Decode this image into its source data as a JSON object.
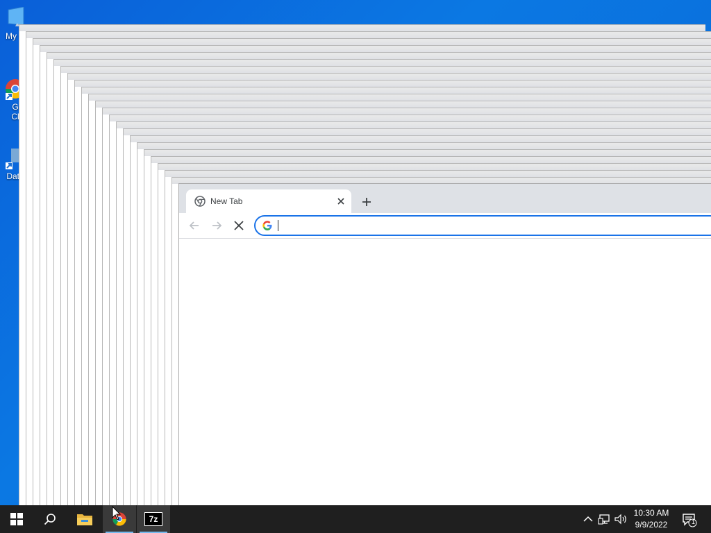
{
  "desktop": {
    "icons": [
      {
        "label": "My C",
        "icon": "computer-icon"
      },
      {
        "label": "G\nCl",
        "icon": "chrome-shortcut-icon"
      },
      {
        "label": "Data",
        "icon": "database-shortcut-icon"
      }
    ]
  },
  "browser": {
    "tab_title": "New Tab",
    "omnibox_value": "",
    "colors": {
      "accent": "#1a73e8",
      "tabstrip": "#dee1e6"
    }
  },
  "taskbar": {
    "apps": [
      "start-icon",
      "search-icon",
      "file-explorer-icon",
      "chrome-icon",
      "7zip-icon"
    ],
    "seven_zip_label": "7z",
    "clock_time": "10:30 AM",
    "clock_date": "9/9/2022",
    "notification_count": "1"
  }
}
